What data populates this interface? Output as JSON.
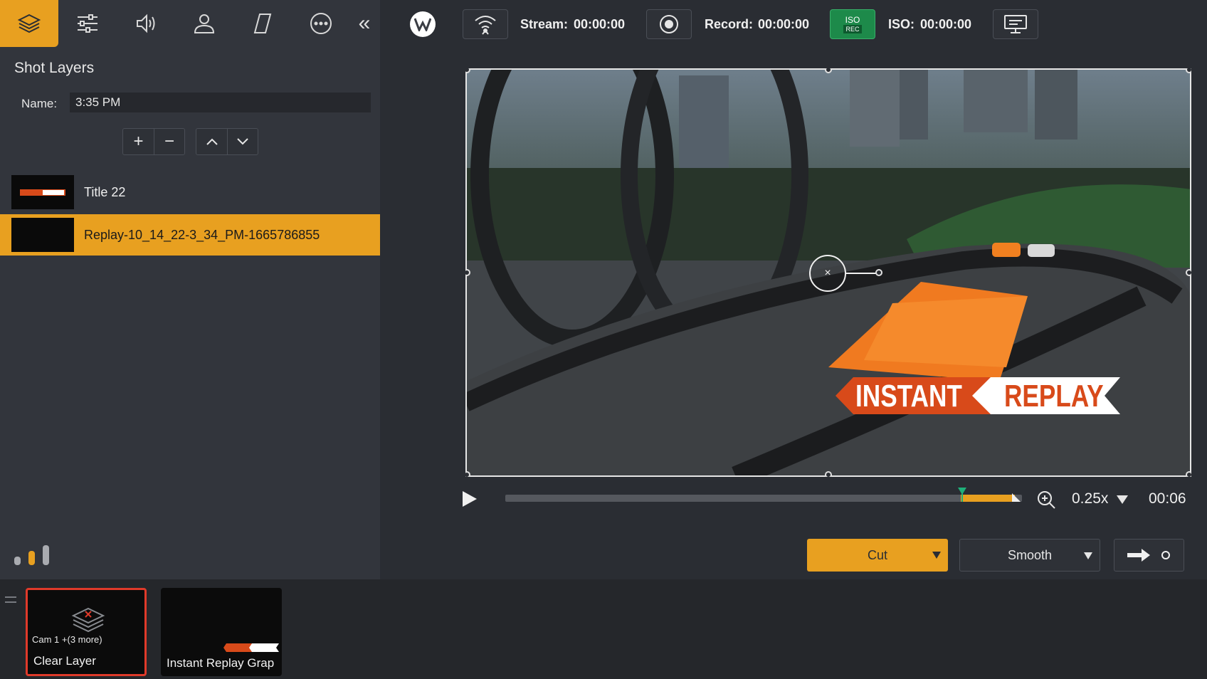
{
  "toolbar": {
    "icons": [
      "layers-icon",
      "sliders-icon",
      "speaker-icon",
      "person-icon",
      "parallelogram-icon",
      "more-icon",
      "collapse-icon"
    ]
  },
  "panel": {
    "title": "Shot Layers",
    "name_label": "Name:",
    "name_value": "3:35 PM"
  },
  "layers": [
    {
      "label": "Title 22",
      "selected": false
    },
    {
      "label": "Replay-10_14_22-3_34_PM-1665786855",
      "selected": true
    }
  ],
  "topbar": {
    "stream_label": "Stream:",
    "stream_time": "00:00:00",
    "record_label": "Record:",
    "record_time": "00:00:00",
    "iso_badge_top": "ISO",
    "iso_badge_bottom": "REC",
    "iso_label": "ISO:",
    "iso_time": "00:00:00"
  },
  "preview": {
    "overlay_left": "INSTANT",
    "overlay_right": "REPLAY"
  },
  "transport": {
    "speed": "0.25x",
    "time": "00:06"
  },
  "transitions": {
    "cut_label": "Cut",
    "smooth_label": "Smooth"
  },
  "shots": [
    {
      "title": "Clear Layer",
      "subtitle": "Cam 1 +(3 more)",
      "live": true
    },
    {
      "title": "Instant Replay Grap",
      "live": false
    }
  ],
  "colors": {
    "accent": "#e8a020",
    "live_border": "#e03a2a",
    "iso_green": "#1d8a4a",
    "overlay_red": "#d84a1a"
  }
}
